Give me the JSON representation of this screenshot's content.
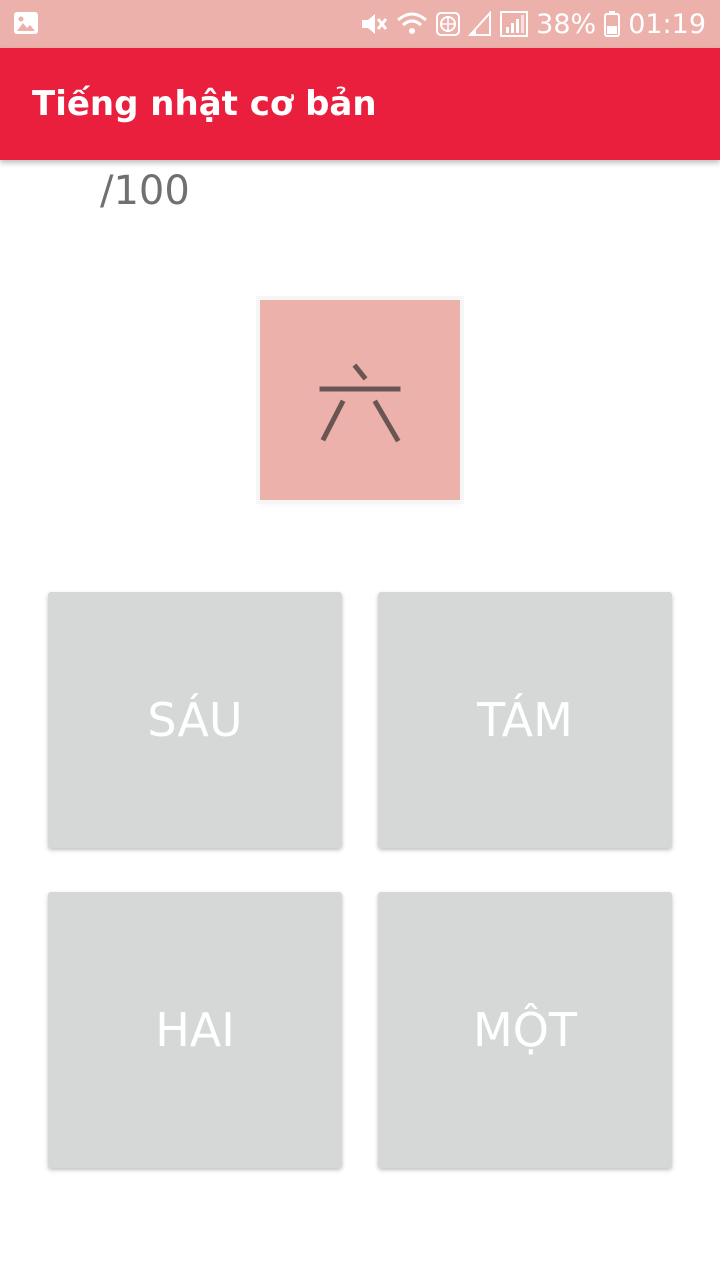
{
  "status_bar": {
    "battery_percent": "38%",
    "time": "01:19",
    "icons": [
      "image-notification-icon",
      "mute-icon",
      "wifi-icon",
      "globe-icon",
      "signal-icon",
      "signal-icon",
      "battery-icon"
    ]
  },
  "app_bar": {
    "title": "Tiếng nhật cơ bản",
    "color": "#ea1f3d"
  },
  "quiz": {
    "score": "/100",
    "kanji": "六",
    "card_color": "#ecb1ab",
    "answers": [
      {
        "label": "SÁU"
      },
      {
        "label": "TÁM"
      },
      {
        "label": "HAI"
      },
      {
        "label": "MỘT"
      }
    ]
  }
}
